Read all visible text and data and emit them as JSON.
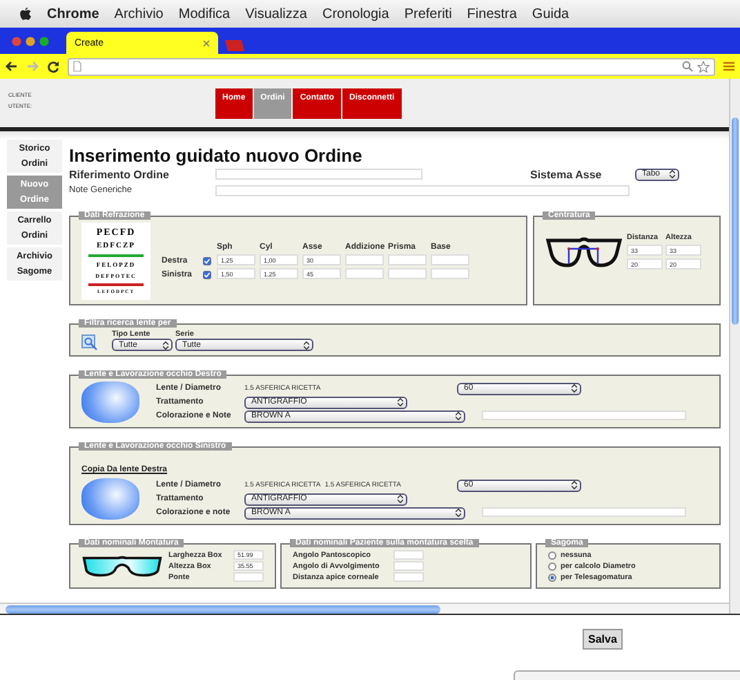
{
  "menubar": {
    "app": "Chrome",
    "items": [
      "Archivio",
      "Modifica",
      "Visualizza",
      "Cronologia",
      "Preferiti",
      "Finestra",
      "Guida"
    ]
  },
  "browser_tabs": [
    {
      "title": "Create",
      "selected": true
    }
  ],
  "header": {
    "labels": [
      "CLIENTE",
      "UTENTE:"
    ],
    "nav": [
      {
        "label": "Home",
        "selected": false
      },
      {
        "label": "Ordini",
        "selected": true
      },
      {
        "label": "Contatto",
        "selected": false
      },
      {
        "label": "Disconnetti",
        "selected": false
      }
    ]
  },
  "sidebar": [
    {
      "label": "Storico Ordini",
      "selected": false
    },
    {
      "label": "Nuovo Ordine",
      "selected": true
    },
    {
      "label": "Carrello Ordini",
      "selected": false
    },
    {
      "label": "Archivio Sagome",
      "selected": false
    }
  ],
  "title": "Inserimento guidato nuovo Ordine",
  "riferimento_label": "Riferimento Ordine",
  "note_label": "Note Generiche",
  "sistema_asse": {
    "label": "Sistema Asse",
    "value": "Tabo"
  },
  "refrazione": {
    "legend": "Dati Refrazione",
    "eye_chart": [
      "PECFD",
      "EDFCZP",
      "FELOPZD",
      "DEFPOTEC",
      "LEFODPCT"
    ],
    "columns": [
      "Sph",
      "Cyl",
      "Asse",
      "Addizione",
      "Prisma",
      "Base"
    ],
    "rows": [
      {
        "label": "Destra",
        "checked": true,
        "values": [
          "1,25",
          "1,00",
          "30"
        ]
      },
      {
        "label": "Sinistra",
        "checked": true,
        "values": [
          "1,50",
          "1,25",
          "45"
        ]
      }
    ]
  },
  "centratura": {
    "legend": "Centratura",
    "columns": [
      "Distanza",
      "Altezza"
    ],
    "rows": [
      [
        "33",
        "33"
      ],
      [
        "20",
        "20"
      ]
    ]
  },
  "filtro": {
    "legend": "Filtra ricerca lente per",
    "fields": [
      {
        "label": "Tipo Lente",
        "value": "Tutte"
      },
      {
        "label": "Serie",
        "value": "Tutte"
      }
    ]
  },
  "lente_destra": {
    "legend": "Lente e Lavorazione occhio Destro",
    "lente_label": "Lente / Diametro",
    "lente_value": "1.5 ASFERICA RICETTA",
    "diametro": "60",
    "trattamento_label": "Trattamento",
    "trattamento": "ANTIGRAFFIO",
    "colorazione_label": "Colorazione e Note",
    "colorazione": "BROWN A"
  },
  "lente_sinistra": {
    "legend": "Lente e Lavorazione occhio Sinistro",
    "copy_link": "Copia Da lente Destra",
    "lente_label": "Lente / Diametro",
    "extra_text": "1.5 ASFERICA RICETTA",
    "lente_value": "1.5 ASFERICA RICETTA",
    "diametro": "60",
    "trattamento_label": "Trattamento",
    "trattamento": "ANTIGRAFFIO",
    "colorazione_label": "Colorazione e note",
    "colorazione": "BROWN A"
  },
  "montatura": {
    "legend": "Dati nominali Montatura",
    "fields": [
      {
        "label": "Larghezza Box",
        "value": "51.99"
      },
      {
        "label": "Altezza Box",
        "value": "35.55"
      },
      {
        "label": "Ponte"
      }
    ]
  },
  "paziente": {
    "legend": "Dati nominali Paziente sulla montatura scelta",
    "fields": [
      "Angolo Pantoscopico",
      "Angolo di Avvolgimento",
      "Distanza apice corneale"
    ]
  },
  "sagoma": {
    "legend": "Sagoma",
    "options": [
      {
        "label": "nessuna",
        "selected": false
      },
      {
        "label": "per calcolo Diametro",
        "selected": false
      },
      {
        "label": "per Telesagomatura",
        "selected": true
      }
    ]
  },
  "save_button": "Salva"
}
